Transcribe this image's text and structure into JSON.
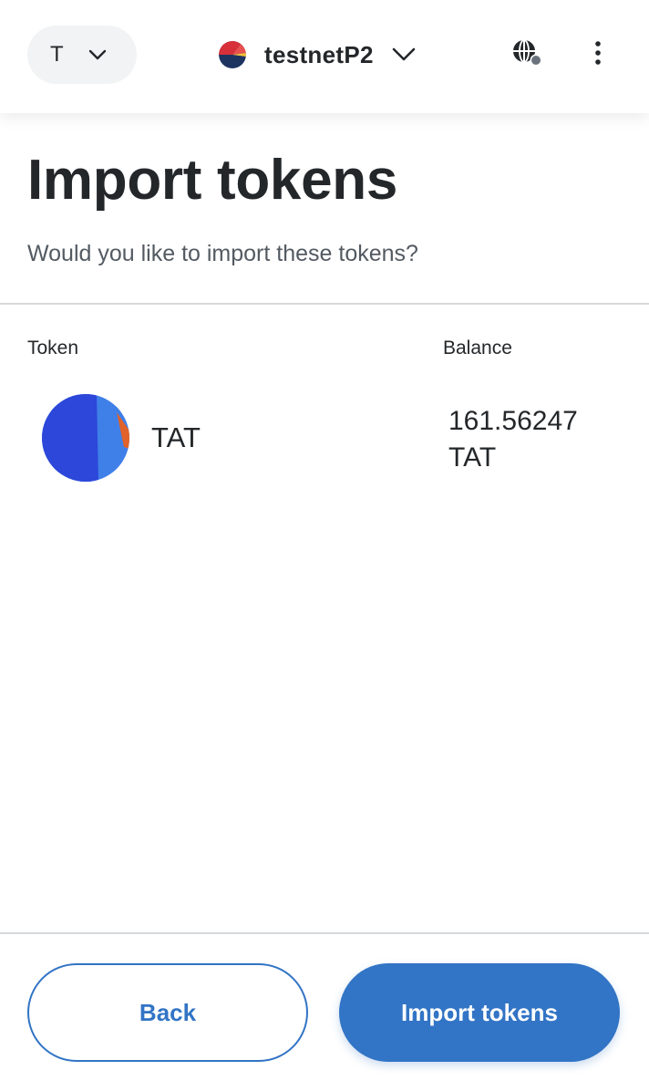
{
  "header": {
    "account_initial": "T",
    "network_name": "testnetP2"
  },
  "page": {
    "title": "Import tokens",
    "subtitle": "Would you like to import these tokens?"
  },
  "table": {
    "columns": {
      "token": "Token",
      "balance": "Balance"
    },
    "rows": [
      {
        "symbol": "TAT",
        "balance_amount": "161.56247",
        "balance_symbol": "TAT"
      }
    ]
  },
  "footer": {
    "back_label": "Back",
    "import_label": "Import tokens"
  },
  "colors": {
    "primary": "#3274c5",
    "text": "#24272a",
    "muted_text": "#535a61",
    "divider": "#d6d9dc"
  },
  "icons": {
    "account_chevron": "chevron-down-icon",
    "network_chevron": "chevron-down-icon",
    "connection": "globe-icon",
    "menu": "kebab-menu-icon"
  }
}
